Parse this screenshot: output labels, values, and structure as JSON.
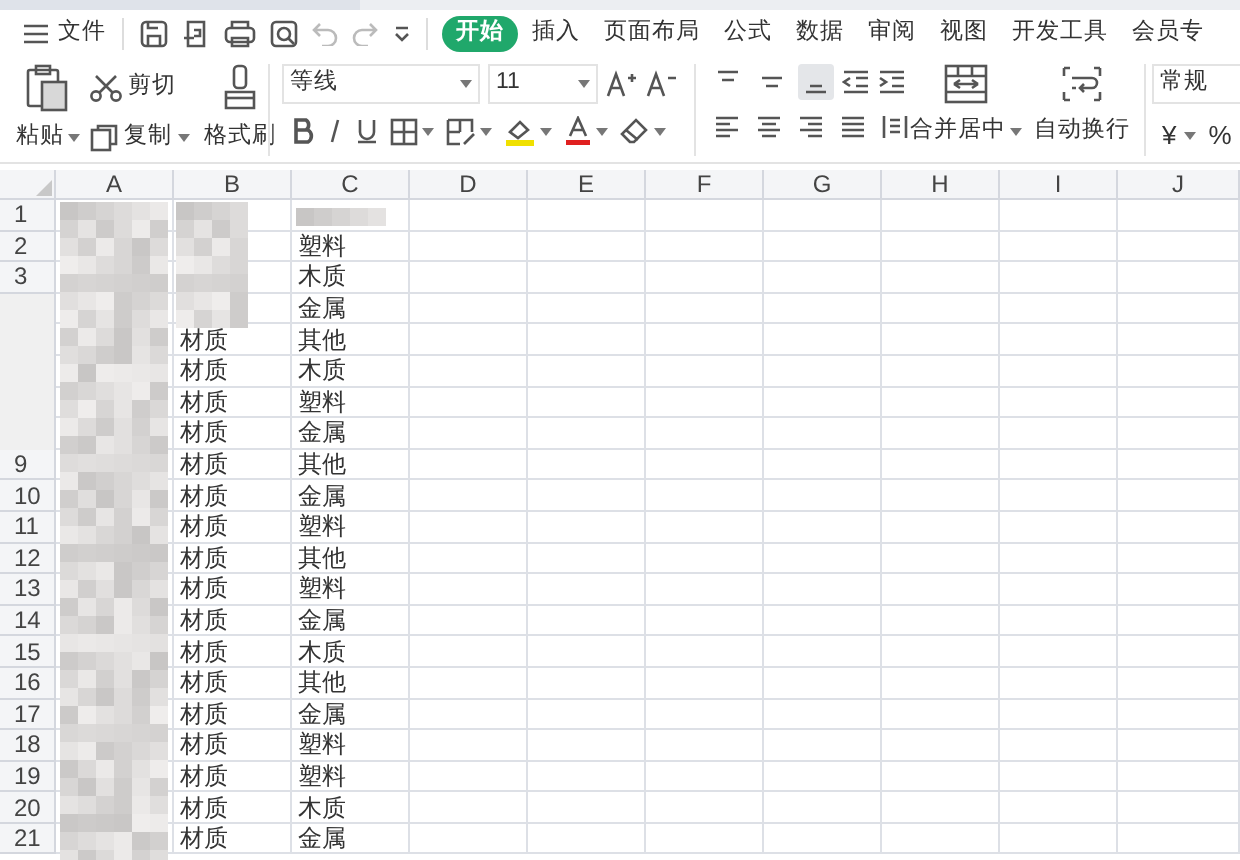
{
  "menu": {
    "file_label": "文件",
    "tabs": [
      {
        "label": "开始",
        "selected": true
      },
      {
        "label": "插入",
        "selected": false
      },
      {
        "label": "页面布局",
        "selected": false
      },
      {
        "label": "公式",
        "selected": false
      },
      {
        "label": "数据",
        "selected": false
      },
      {
        "label": "审阅",
        "selected": false
      },
      {
        "label": "视图",
        "selected": false
      },
      {
        "label": "开发工具",
        "selected": false
      },
      {
        "label": "会员专",
        "selected": false
      }
    ]
  },
  "ribbon": {
    "paste": "粘贴",
    "cut": "剪切",
    "copy": "复制",
    "format_painter": "格式刷",
    "font_name": "等线",
    "font_size": "11",
    "vertical_align": [
      {
        "selected": false
      },
      {
        "selected": false
      },
      {
        "selected": true
      }
    ],
    "merge": "合并居中",
    "wrap": "自动换行",
    "number_format": "常规",
    "currency": "¥",
    "percent": "%"
  },
  "sheet": {
    "columns": [
      "A",
      "B",
      "C",
      "D",
      "E",
      "F",
      "G",
      "H",
      "I",
      "J"
    ],
    "rows": [
      {
        "number": "1"
      },
      {
        "number": "2",
        "c": "塑料"
      },
      {
        "number": "3",
        "c": "木质"
      },
      {
        "c": "金属"
      },
      {
        "b": "材质",
        "c": "其他"
      },
      {
        "b": "材质",
        "c": "木质"
      },
      {
        "b": "材质",
        "c": "塑料"
      },
      {
        "b": "材质",
        "c": "金属"
      },
      {
        "number": "9",
        "b": "材质",
        "c": "其他"
      },
      {
        "number": "10",
        "b": "材质",
        "c": "金属"
      },
      {
        "number": "11",
        "b": "材质",
        "c": "塑料"
      },
      {
        "number": "12",
        "b": "材质",
        "c": "其他"
      },
      {
        "number": "13",
        "b": "材质",
        "c": "塑料"
      },
      {
        "number": "14",
        "b": "材质",
        "c": "金属"
      },
      {
        "number": "15",
        "b": "材质",
        "c": "木质"
      },
      {
        "number": "16",
        "b": "材质",
        "c": "其他"
      },
      {
        "number": "17",
        "b": "材质",
        "c": "金属"
      },
      {
        "number": "18",
        "b": "材质",
        "c": "塑料"
      },
      {
        "number": "19",
        "b": "材质",
        "c": "塑料"
      },
      {
        "number": "20",
        "b": "材质",
        "c": "木质"
      },
      {
        "number": "21",
        "b": "材质",
        "c": "金属"
      }
    ]
  }
}
